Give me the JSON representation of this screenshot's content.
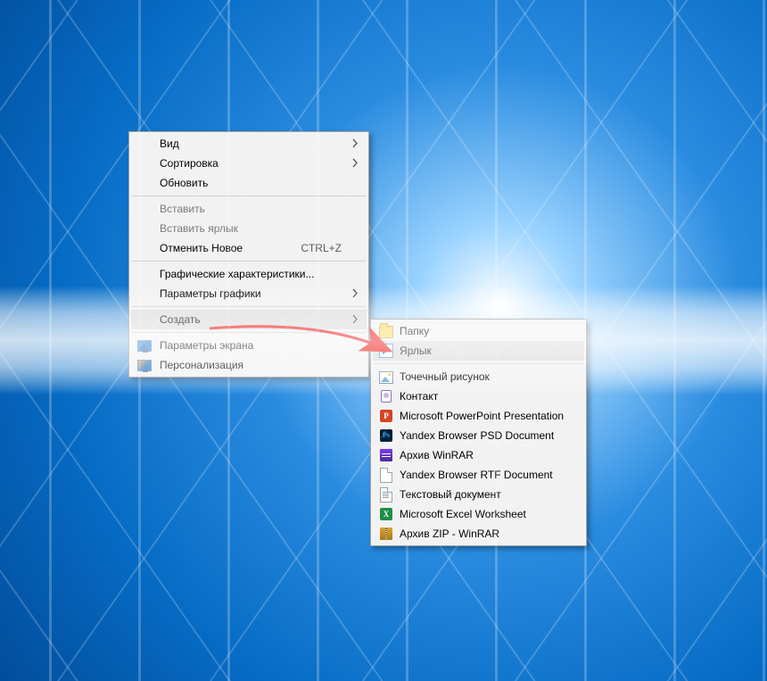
{
  "contextMenu": {
    "items": [
      {
        "label": "Вид",
        "type": "submenu"
      },
      {
        "label": "Сортировка",
        "type": "submenu"
      },
      {
        "label": "Обновить"
      },
      {
        "type": "sep"
      },
      {
        "label": "Вставить",
        "disabled": true
      },
      {
        "label": "Вставить ярлык",
        "disabled": true
      },
      {
        "label": "Отменить Новое",
        "accel": "CTRL+Z"
      },
      {
        "type": "sep"
      },
      {
        "label": "Графические характеристики..."
      },
      {
        "label": "Параметры графики",
        "type": "submenu"
      },
      {
        "type": "sep"
      },
      {
        "label": "Создать",
        "type": "submenu",
        "highlight": true
      },
      {
        "type": "sep"
      },
      {
        "label": "Параметры экрана",
        "icon": "monitor"
      },
      {
        "label": "Персонализация",
        "icon": "personalize"
      }
    ]
  },
  "submenu": {
    "title": "Создать",
    "items": [
      {
        "label": "Папку",
        "icon": "folder"
      },
      {
        "label": "Ярлык",
        "icon": "shortcut",
        "highlight": true
      },
      {
        "type": "sep"
      },
      {
        "label": "Точечный рисунок",
        "icon": "bmp"
      },
      {
        "label": "Контакт",
        "icon": "contact"
      },
      {
        "label": "Microsoft PowerPoint Presentation",
        "icon": "ppt"
      },
      {
        "label": "Yandex Browser PSD Document",
        "icon": "psd"
      },
      {
        "label": "Архив WinRAR",
        "icon": "rar"
      },
      {
        "label": "Yandex Browser RTF Document",
        "icon": "file"
      },
      {
        "label": "Текстовый документ",
        "icon": "txt"
      },
      {
        "label": "Microsoft Excel Worksheet",
        "icon": "xls"
      },
      {
        "label": "Архив ZIP - WinRAR",
        "icon": "zip"
      }
    ]
  },
  "annotation": {
    "type": "arrow",
    "color": "#e11"
  }
}
